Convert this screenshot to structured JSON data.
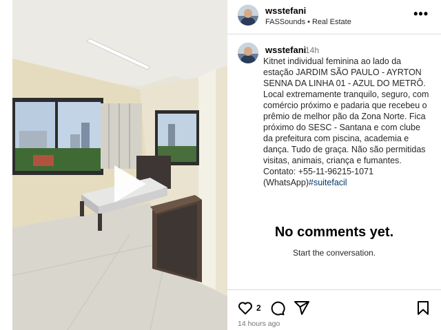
{
  "media": {
    "play_icon": "play-icon"
  },
  "header": {
    "username": "wsstefani",
    "audio": "FASSounds",
    "separator": "•",
    "category": "Real Estate",
    "more_icon": "more-horizontal-icon",
    "more_label": "•••"
  },
  "caption": {
    "username": "wsstefani",
    "time": "14h",
    "text": "Kitnet individual feminina ao lado da estação JARDIM SÃO PAULO - AYRTON SENNA DA LINHA 01 - AZUL DO METRÔ. Local extremamente tranquilo, seguro, com comércio próximo e padaria que recebeu o prêmio de melhor pão da Zona Norte. Fica próximo do SESC - Santana e com clube da prefeitura com piscina, academia e dança. Tudo de graça. Não são permitidas visitas, animais, criança e fumantes. Contato: +55-11-96215-1071 (WhatsApp)",
    "hashtag": "#suitefacil"
  },
  "comments": {
    "empty_title": "No comments yet.",
    "empty_subtitle": "Start the conversation."
  },
  "actions": {
    "like_count": "2",
    "posted_ago": "14 hours ago",
    "icons": [
      "heart-icon",
      "comment-icon",
      "share-icon",
      "bookmark-icon"
    ]
  }
}
